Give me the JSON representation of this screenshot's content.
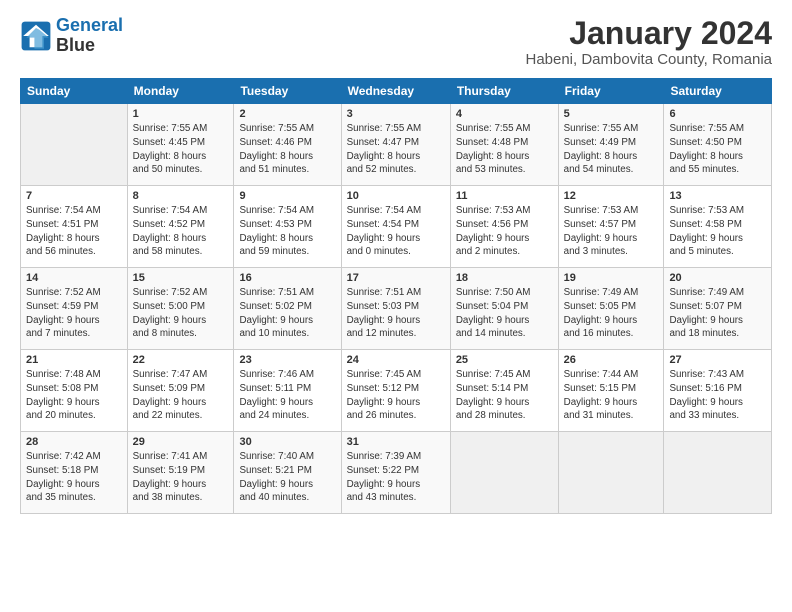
{
  "logo": {
    "line1": "General",
    "line2": "Blue"
  },
  "title": "January 2024",
  "location": "Habeni, Dambovita County, Romania",
  "weekdays": [
    "Sunday",
    "Monday",
    "Tuesday",
    "Wednesday",
    "Thursday",
    "Friday",
    "Saturday"
  ],
  "weeks": [
    [
      {
        "day": "",
        "info": ""
      },
      {
        "day": "1",
        "info": "Sunrise: 7:55 AM\nSunset: 4:45 PM\nDaylight: 8 hours\nand 50 minutes."
      },
      {
        "day": "2",
        "info": "Sunrise: 7:55 AM\nSunset: 4:46 PM\nDaylight: 8 hours\nand 51 minutes."
      },
      {
        "day": "3",
        "info": "Sunrise: 7:55 AM\nSunset: 4:47 PM\nDaylight: 8 hours\nand 52 minutes."
      },
      {
        "day": "4",
        "info": "Sunrise: 7:55 AM\nSunset: 4:48 PM\nDaylight: 8 hours\nand 53 minutes."
      },
      {
        "day": "5",
        "info": "Sunrise: 7:55 AM\nSunset: 4:49 PM\nDaylight: 8 hours\nand 54 minutes."
      },
      {
        "day": "6",
        "info": "Sunrise: 7:55 AM\nSunset: 4:50 PM\nDaylight: 8 hours\nand 55 minutes."
      }
    ],
    [
      {
        "day": "7",
        "info": "Sunrise: 7:54 AM\nSunset: 4:51 PM\nDaylight: 8 hours\nand 56 minutes."
      },
      {
        "day": "8",
        "info": "Sunrise: 7:54 AM\nSunset: 4:52 PM\nDaylight: 8 hours\nand 58 minutes."
      },
      {
        "day": "9",
        "info": "Sunrise: 7:54 AM\nSunset: 4:53 PM\nDaylight: 8 hours\nand 59 minutes."
      },
      {
        "day": "10",
        "info": "Sunrise: 7:54 AM\nSunset: 4:54 PM\nDaylight: 9 hours\nand 0 minutes."
      },
      {
        "day": "11",
        "info": "Sunrise: 7:53 AM\nSunset: 4:56 PM\nDaylight: 9 hours\nand 2 minutes."
      },
      {
        "day": "12",
        "info": "Sunrise: 7:53 AM\nSunset: 4:57 PM\nDaylight: 9 hours\nand 3 minutes."
      },
      {
        "day": "13",
        "info": "Sunrise: 7:53 AM\nSunset: 4:58 PM\nDaylight: 9 hours\nand 5 minutes."
      }
    ],
    [
      {
        "day": "14",
        "info": "Sunrise: 7:52 AM\nSunset: 4:59 PM\nDaylight: 9 hours\nand 7 minutes."
      },
      {
        "day": "15",
        "info": "Sunrise: 7:52 AM\nSunset: 5:00 PM\nDaylight: 9 hours\nand 8 minutes."
      },
      {
        "day": "16",
        "info": "Sunrise: 7:51 AM\nSunset: 5:02 PM\nDaylight: 9 hours\nand 10 minutes."
      },
      {
        "day": "17",
        "info": "Sunrise: 7:51 AM\nSunset: 5:03 PM\nDaylight: 9 hours\nand 12 minutes."
      },
      {
        "day": "18",
        "info": "Sunrise: 7:50 AM\nSunset: 5:04 PM\nDaylight: 9 hours\nand 14 minutes."
      },
      {
        "day": "19",
        "info": "Sunrise: 7:49 AM\nSunset: 5:05 PM\nDaylight: 9 hours\nand 16 minutes."
      },
      {
        "day": "20",
        "info": "Sunrise: 7:49 AM\nSunset: 5:07 PM\nDaylight: 9 hours\nand 18 minutes."
      }
    ],
    [
      {
        "day": "21",
        "info": "Sunrise: 7:48 AM\nSunset: 5:08 PM\nDaylight: 9 hours\nand 20 minutes."
      },
      {
        "day": "22",
        "info": "Sunrise: 7:47 AM\nSunset: 5:09 PM\nDaylight: 9 hours\nand 22 minutes."
      },
      {
        "day": "23",
        "info": "Sunrise: 7:46 AM\nSunset: 5:11 PM\nDaylight: 9 hours\nand 24 minutes."
      },
      {
        "day": "24",
        "info": "Sunrise: 7:45 AM\nSunset: 5:12 PM\nDaylight: 9 hours\nand 26 minutes."
      },
      {
        "day": "25",
        "info": "Sunrise: 7:45 AM\nSunset: 5:14 PM\nDaylight: 9 hours\nand 28 minutes."
      },
      {
        "day": "26",
        "info": "Sunrise: 7:44 AM\nSunset: 5:15 PM\nDaylight: 9 hours\nand 31 minutes."
      },
      {
        "day": "27",
        "info": "Sunrise: 7:43 AM\nSunset: 5:16 PM\nDaylight: 9 hours\nand 33 minutes."
      }
    ],
    [
      {
        "day": "28",
        "info": "Sunrise: 7:42 AM\nSunset: 5:18 PM\nDaylight: 9 hours\nand 35 minutes."
      },
      {
        "day": "29",
        "info": "Sunrise: 7:41 AM\nSunset: 5:19 PM\nDaylight: 9 hours\nand 38 minutes."
      },
      {
        "day": "30",
        "info": "Sunrise: 7:40 AM\nSunset: 5:21 PM\nDaylight: 9 hours\nand 40 minutes."
      },
      {
        "day": "31",
        "info": "Sunrise: 7:39 AM\nSunset: 5:22 PM\nDaylight: 9 hours\nand 43 minutes."
      },
      {
        "day": "",
        "info": ""
      },
      {
        "day": "",
        "info": ""
      },
      {
        "day": "",
        "info": ""
      }
    ]
  ]
}
